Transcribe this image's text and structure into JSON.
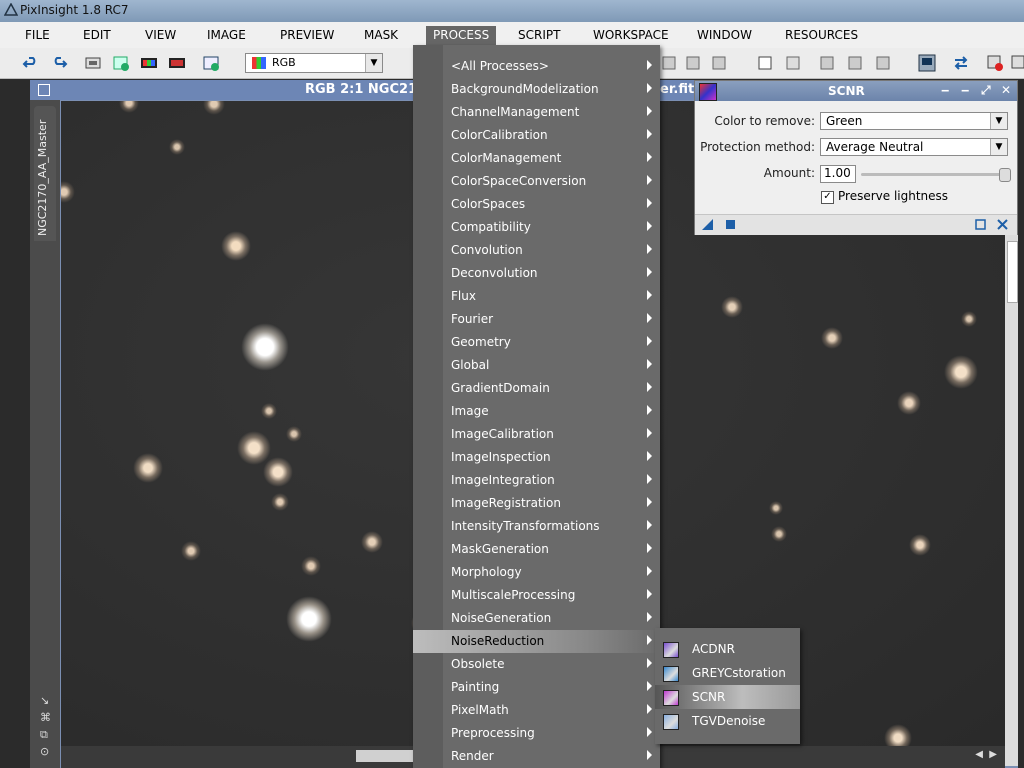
{
  "app": {
    "title": "PixInsight 1.8 RC7"
  },
  "menubar": [
    {
      "label": "FILE"
    },
    {
      "label": "EDIT"
    },
    {
      "label": "VIEW"
    },
    {
      "label": "IMAGE"
    },
    {
      "label": "PREVIEW"
    },
    {
      "label": "MASK"
    },
    {
      "label": "PROCESS"
    },
    {
      "label": "SCRIPT"
    },
    {
      "label": "WORKSPACE"
    },
    {
      "label": "WINDOW"
    },
    {
      "label": "RESOURCES"
    }
  ],
  "toolbar": {
    "channel_select": "RGB"
  },
  "image_window": {
    "title_left": "RGB 2:1 NGC21",
    "title_right": "er.fit",
    "side_tab": "NGC2170_AA_Master"
  },
  "scnr": {
    "title": "SCNR",
    "color_label": "Color to remove:",
    "color_value": "Green",
    "protection_label": "Protection method:",
    "protection_value": "Average Neutral",
    "amount_label": "Amount:",
    "amount_value": "1.00",
    "amount_fraction": 1.0,
    "preserve_label": "Preserve lightness",
    "preserve_checked": true
  },
  "process_menu": {
    "items": [
      "<All Processes>",
      "BackgroundModelization",
      "ChannelManagement",
      "ColorCalibration",
      "ColorManagement",
      "ColorSpaceConversion",
      "ColorSpaces",
      "Compatibility",
      "Convolution",
      "Deconvolution",
      "Flux",
      "Fourier",
      "Geometry",
      "Global",
      "GradientDomain",
      "Image",
      "ImageCalibration",
      "ImageInspection",
      "ImageIntegration",
      "ImageRegistration",
      "IntensityTransformations",
      "MaskGeneration",
      "Morphology",
      "MultiscaleProcessing",
      "NoiseGeneration",
      "NoiseReduction",
      "Obsolete",
      "Painting",
      "PixelMath",
      "Preprocessing",
      "Render"
    ],
    "highlighted": "NoiseReduction"
  },
  "noise_reduction_submenu": {
    "items": [
      {
        "label": "ACDNR",
        "icon": "acdnr-icon",
        "color": "#7a4fd0"
      },
      {
        "label": "GREYCstoration",
        "icon": "greycstoration-icon",
        "color": "#3a8ad0"
      },
      {
        "label": "SCNR",
        "icon": "scnr-icon",
        "color": "#c03ad0"
      },
      {
        "label": "TGVDenoise",
        "icon": "tgvdenoise-icon",
        "color": "#8ab0e0"
      }
    ],
    "highlighted": "SCNR"
  }
}
